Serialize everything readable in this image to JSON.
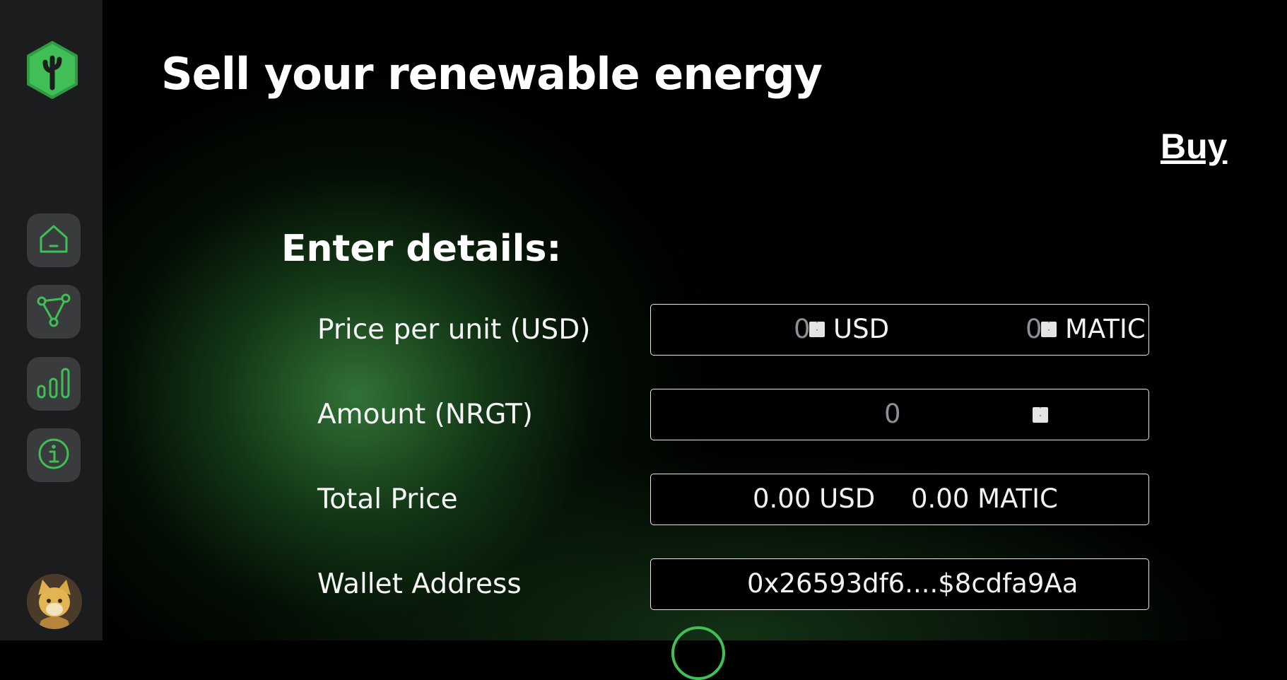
{
  "sidebar": {
    "logo_icon": "plant-hexagon-logo",
    "items": [
      {
        "icon": "home-icon"
      },
      {
        "icon": "network-triangle-icon"
      },
      {
        "icon": "bar-chart-icon"
      },
      {
        "icon": "info-icon"
      }
    ],
    "avatar_icon": "user-avatar"
  },
  "header": {
    "title": "Sell your renewable energy",
    "buy_link": "Buy"
  },
  "form": {
    "section_title": "Enter details:",
    "price_label": "Price per unit (USD)",
    "price_usd_value": "0",
    "price_usd_unit": "USD",
    "price_matic_value": "0",
    "price_matic_unit": "MATIC",
    "amount_label": "Amount (NRGT)",
    "amount_value": "0",
    "total_label": "Total Price",
    "total_usd": "0.00 USD",
    "total_matic": "0.00 MATIC",
    "wallet_label": "Wallet Address",
    "wallet_value": "0x26593df6....$8cdfa9Aa"
  },
  "colors": {
    "accent": "#3fbf56",
    "sidebar_bg": "#1b1c1e",
    "nav_button_bg": "#3a3b3d"
  }
}
